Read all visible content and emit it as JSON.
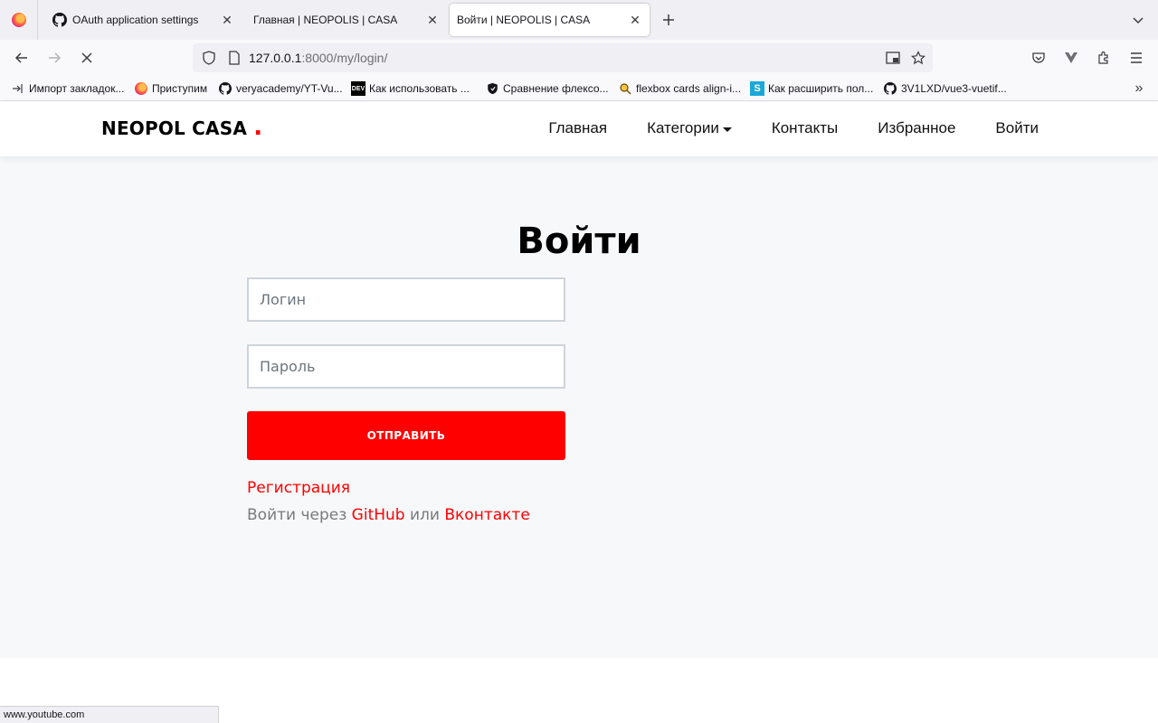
{
  "browser": {
    "tabs": [
      {
        "title": "OAuth application settings",
        "icon": "github-icon"
      },
      {
        "title": "Главная | NEOPOLIS | CASA",
        "icon": "none"
      },
      {
        "title": "Войти | NEOPOLIS | CASA",
        "icon": "none",
        "active": true
      }
    ],
    "url_host": "127.0.0.1",
    "url_path": ":8000/my/login/",
    "bookmarks": [
      {
        "label": "Импорт закладок...",
        "icon": "import-icon"
      },
      {
        "label": "Приступим",
        "icon": "firefox-icon"
      },
      {
        "label": "veryacademy/YT-Vu...",
        "icon": "github-icon"
      },
      {
        "label": "Как использовать ...",
        "icon": "dev-icon"
      },
      {
        "label": "Сравнение флексо...",
        "icon": "shield-icon"
      },
      {
        "label": "flexbox cards align-i...",
        "icon": "search-icon"
      },
      {
        "label": "Как расширить пол...",
        "icon": "s-icon"
      },
      {
        "label": "3V1LXD/vue3-vuetif...",
        "icon": "github-icon"
      }
    ],
    "status_text": "www.youtube.com"
  },
  "site": {
    "logo": "NEOPOL CASA",
    "logo_dot": ".",
    "nav": {
      "home": "Главная",
      "categories": "Категории",
      "contacts": "Контакты",
      "favorites": "Избранное",
      "login": "Войти"
    },
    "login": {
      "title": "Войти",
      "username_placeholder": "Логин",
      "password_placeholder": "Пароль",
      "submit": "ОТПРАВИТЬ",
      "register": "Регистрация",
      "social_prefix": "Войти через",
      "github": "GitHub",
      "or": "или",
      "vk": "Вконтакте"
    }
  },
  "colors": {
    "accent": "#ff0000",
    "page_bg": "#f7f8fa"
  }
}
